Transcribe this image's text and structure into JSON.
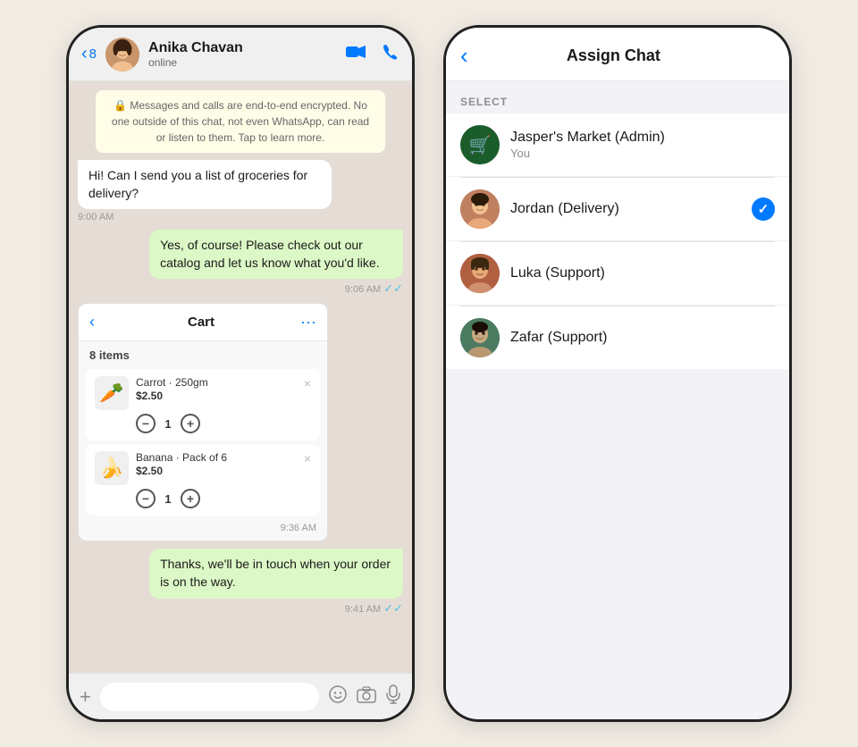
{
  "leftPhone": {
    "header": {
      "back_label": "8",
      "contact_name": "Anika Chavan",
      "status": "online"
    },
    "encryption_notice": "🔒 Messages and calls are end-to-end encrypted. No one outside of this chat, not even WhatsApp, can read or listen to them. Tap to learn more.",
    "messages": [
      {
        "id": "msg1",
        "type": "received",
        "text": "Hi! Can I send you a list of groceries for delivery?",
        "time": "9:00 AM",
        "ticks": null
      },
      {
        "id": "msg2",
        "type": "sent",
        "text": "Yes, of course! Please check out our catalog and let us know what you'd like.",
        "time": "9:06 AM",
        "ticks": "✓✓"
      }
    ],
    "cart": {
      "title": "Cart",
      "count_label": "8 items",
      "items": [
        {
          "name": "Carrot · 250gm",
          "price": "$2.50",
          "qty": "1",
          "emoji": "🥕"
        },
        {
          "name": "Banana · Pack of 6",
          "price": "$2.50",
          "qty": "1",
          "emoji": "🍌"
        }
      ],
      "timestamp": "9:36 AM"
    },
    "last_message": {
      "type": "sent",
      "text": "Thanks, we'll be in touch when your order is on the way.",
      "time": "9:41 AM",
      "ticks": "✓✓"
    },
    "input_placeholder": ""
  },
  "rightPhone": {
    "header": {
      "title": "Assign Chat"
    },
    "section_label": "SELECT",
    "agents": [
      {
        "id": "agent1",
        "name": "Jasper's Market (Admin)",
        "sub": "You",
        "avatar_type": "jaspers",
        "selected": false
      },
      {
        "id": "agent2",
        "name": "Jordan (Delivery)",
        "sub": "",
        "avatar_type": "person1",
        "selected": true
      },
      {
        "id": "agent3",
        "name": "Luka (Support)",
        "sub": "",
        "avatar_type": "person2",
        "selected": false
      },
      {
        "id": "agent4",
        "name": "Zafar (Support)",
        "sub": "",
        "avatar_type": "person3",
        "selected": false
      }
    ],
    "icons": {
      "check": "✓",
      "back": "‹"
    }
  },
  "icons": {
    "back_chevron": "‹",
    "video_call": "📹",
    "phone_call": "📞",
    "cart_back": "‹",
    "cart_more": "···",
    "close": "×",
    "plus_btn": "+",
    "minus_btn": "−",
    "add_icon": "+",
    "sticker_icon": "🙂",
    "camera_icon": "📷",
    "mic_icon": "🎤"
  }
}
